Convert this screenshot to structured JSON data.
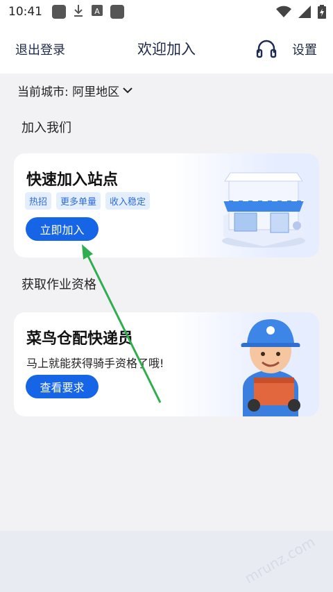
{
  "status_bar": {
    "time": "10:41"
  },
  "header": {
    "logout_label": "退出登录",
    "title": "欢迎加入",
    "settings_label": "设置"
  },
  "city": {
    "label": "当前城市: 阿里地区"
  },
  "sections": {
    "join": "加入我们",
    "qualify": "获取作业资格"
  },
  "card1": {
    "title": "快速加入站点",
    "tags": [
      "热招",
      "更多单量",
      "收入稳定"
    ],
    "button": "立即加入"
  },
  "card2": {
    "title": "菜鸟仓配快递员",
    "subtitle": "马上就能获得骑手资格了哦!",
    "button": "查看要求"
  },
  "watermark": "mrunz.com"
}
